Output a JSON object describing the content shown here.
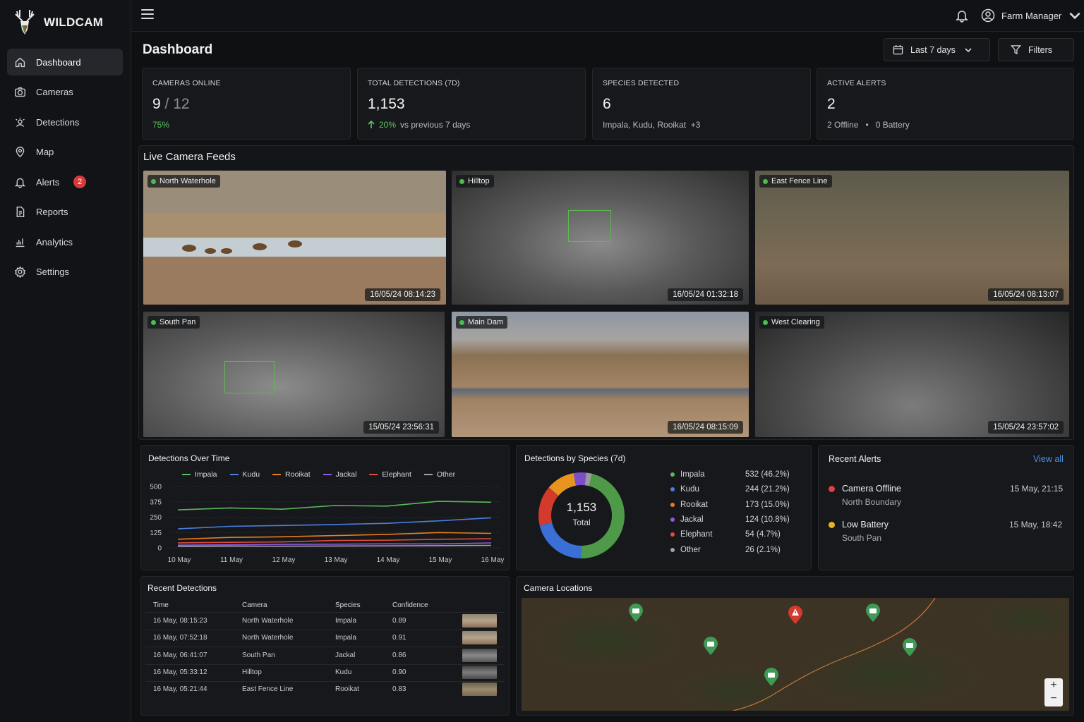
{
  "app": {
    "name": "WILDCAM"
  },
  "sidebar": {
    "items": [
      {
        "label": "Dashboard",
        "icon": "home-icon"
      },
      {
        "label": "Cameras",
        "icon": "camera-icon"
      },
      {
        "label": "Detections",
        "icon": "detections-icon"
      },
      {
        "label": "Map",
        "icon": "map-pin-icon"
      },
      {
        "label": "Alerts",
        "icon": "bell-icon",
        "badge": "2"
      },
      {
        "label": "Reports",
        "icon": "report-icon"
      },
      {
        "label": "Analytics",
        "icon": "bar-chart-icon"
      },
      {
        "label": "Settings",
        "icon": "gear-icon"
      }
    ]
  },
  "header": {
    "user": "Farm Manager"
  },
  "page": {
    "title": "Dashboard",
    "date_range": "Last 7 days",
    "filters": "Filters"
  },
  "stats": {
    "cameras": {
      "label": "CAMERAS ONLINE",
      "value": "9",
      "total": "/ 12",
      "sub": "75%"
    },
    "detections": {
      "label": "TOTAL DETECTIONS (7D)",
      "value": "1,153",
      "change": "20%",
      "sub": "vs previous 7 days"
    },
    "species": {
      "label": "SPECIES DETECTED",
      "value": "6",
      "sub": "Impala, Kudu, Rooikat  +3"
    },
    "alerts": {
      "label": "ACTIVE ALERTS",
      "value": "2",
      "sub1": "2 Offline",
      "sub2": "0 Battery"
    }
  },
  "feeds": {
    "title": "Live Camera Feeds",
    "items": [
      {
        "name": "North Waterhole",
        "time": "16/05/24 08:14:23"
      },
      {
        "name": "Hilltop",
        "time": "16/05/24 01:32:18"
      },
      {
        "name": "East Fence Line",
        "time": "16/05/24 08:13:07"
      },
      {
        "name": "South Pan",
        "time": "15/05/24 23:56:31"
      },
      {
        "name": "Main Dam",
        "time": "16/05/24 08:15:09"
      },
      {
        "name": "West Clearing",
        "time": "15/05/24 23:57:02"
      }
    ]
  },
  "chart_data": [
    {
      "type": "line",
      "title": "Detections Over Time",
      "x": [
        "10 May",
        "11 May",
        "12 May",
        "13 May",
        "14 May",
        "15 May",
        "16 May"
      ],
      "yticks": [
        "500",
        "375",
        "250",
        "125",
        "0"
      ],
      "ylim": [
        0,
        500
      ],
      "grid": true,
      "legend": "top",
      "series": [
        {
          "name": "Impala",
          "color": "#5cb85c",
          "values": [
            310,
            325,
            315,
            345,
            340,
            380,
            372
          ]
        },
        {
          "name": "Kudu",
          "color": "#4a7fe0",
          "values": [
            155,
            175,
            182,
            190,
            200,
            220,
            245
          ]
        },
        {
          "name": "Rooikat",
          "color": "#e87d1e",
          "values": [
            70,
            85,
            90,
            100,
            110,
            125,
            118
          ]
        },
        {
          "name": "Jackal",
          "color": "#8e5be0",
          "values": [
            22,
            25,
            28,
            30,
            33,
            32,
            40
          ]
        },
        {
          "name": "Elephant",
          "color": "#e04a3a",
          "values": [
            40,
            45,
            48,
            60,
            62,
            70,
            74
          ]
        },
        {
          "name": "Other",
          "color": "#a0a3a8",
          "values": [
            12,
            14,
            13,
            15,
            16,
            18,
            20
          ]
        }
      ]
    },
    {
      "type": "pie",
      "title": "Detections by Species (7d)",
      "center_value": "1,153",
      "center_label": "Total",
      "categories": [
        "Impala",
        "Kudu",
        "Rooikat",
        "Jackal",
        "Elephant",
        "Other"
      ],
      "values": [
        532,
        244,
        173,
        124,
        54,
        26
      ],
      "labels": [
        "532 (46.2%)",
        "244 (21.2%)",
        "173 (15.0%)",
        "124 (10.8%)",
        "54 (4.7%)",
        "26 (2.1%)"
      ],
      "colors": [
        "#4e9a48",
        "#3a6fd6",
        "#d33a2c",
        "#e89520",
        "#7a4fc9",
        "#9a9a9a"
      ],
      "dot_colors": [
        "#5cb85c",
        "#4a7fe0",
        "#e87d1e",
        "#8e5be0",
        "#e04a3a",
        "#a0a3a8"
      ]
    }
  ],
  "recent_alerts": {
    "title": "Recent Alerts",
    "view_all": "View all",
    "items": [
      {
        "title": "Camera Offline",
        "sub": "North Boundary",
        "time": "15 May, 21:15",
        "color": "#e04040"
      },
      {
        "title": "Low Battery",
        "sub": "South Pan",
        "time": "15 May, 18:42",
        "color": "#e8b424"
      }
    ]
  },
  "recent_detections": {
    "title": "Recent Detections",
    "headers": [
      "Time",
      "Camera",
      "Species",
      "Confidence"
    ],
    "rows": [
      [
        "16 May, 08:15:23",
        "North Waterhole",
        "Impala",
        "0.89"
      ],
      [
        "16 May, 07:52:18",
        "North Waterhole",
        "Impala",
        "0.91"
      ],
      [
        "16 May, 06:41:07",
        "South Pan",
        "Jackal",
        "0.86"
      ],
      [
        "16 May, 05:33:12",
        "Hilltop",
        "Kudu",
        "0.90"
      ],
      [
        "16 May, 05:21:44",
        "East Fence Line",
        "Rooikat",
        "0.83"
      ]
    ]
  },
  "map": {
    "title": "Camera Locations",
    "zoom_in": "+",
    "zoom_out": "−"
  }
}
